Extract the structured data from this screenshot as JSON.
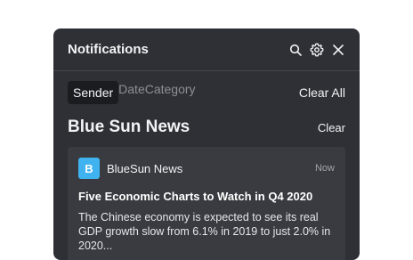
{
  "panel": {
    "title": "Notifications",
    "icons": [
      "search-icon",
      "gear-icon",
      "close-icon"
    ]
  },
  "filters": {
    "tabs": [
      "Sender",
      "Date",
      "Category"
    ],
    "active": "Sender",
    "clear_all": "Clear All"
  },
  "group": {
    "title": "Blue Sun News",
    "clear": "Clear"
  },
  "notification": {
    "avatar_letter": "B",
    "avatar_color": "#3fb2f0",
    "sender": "BlueSun News",
    "time": "Now",
    "headline": "Five Economic Charts to Watch in Q4 2020",
    "body": "The Chinese economy is expected to see its real GDP growth slow from 6.1% in 2019 to just 2.0% in 2020..."
  }
}
